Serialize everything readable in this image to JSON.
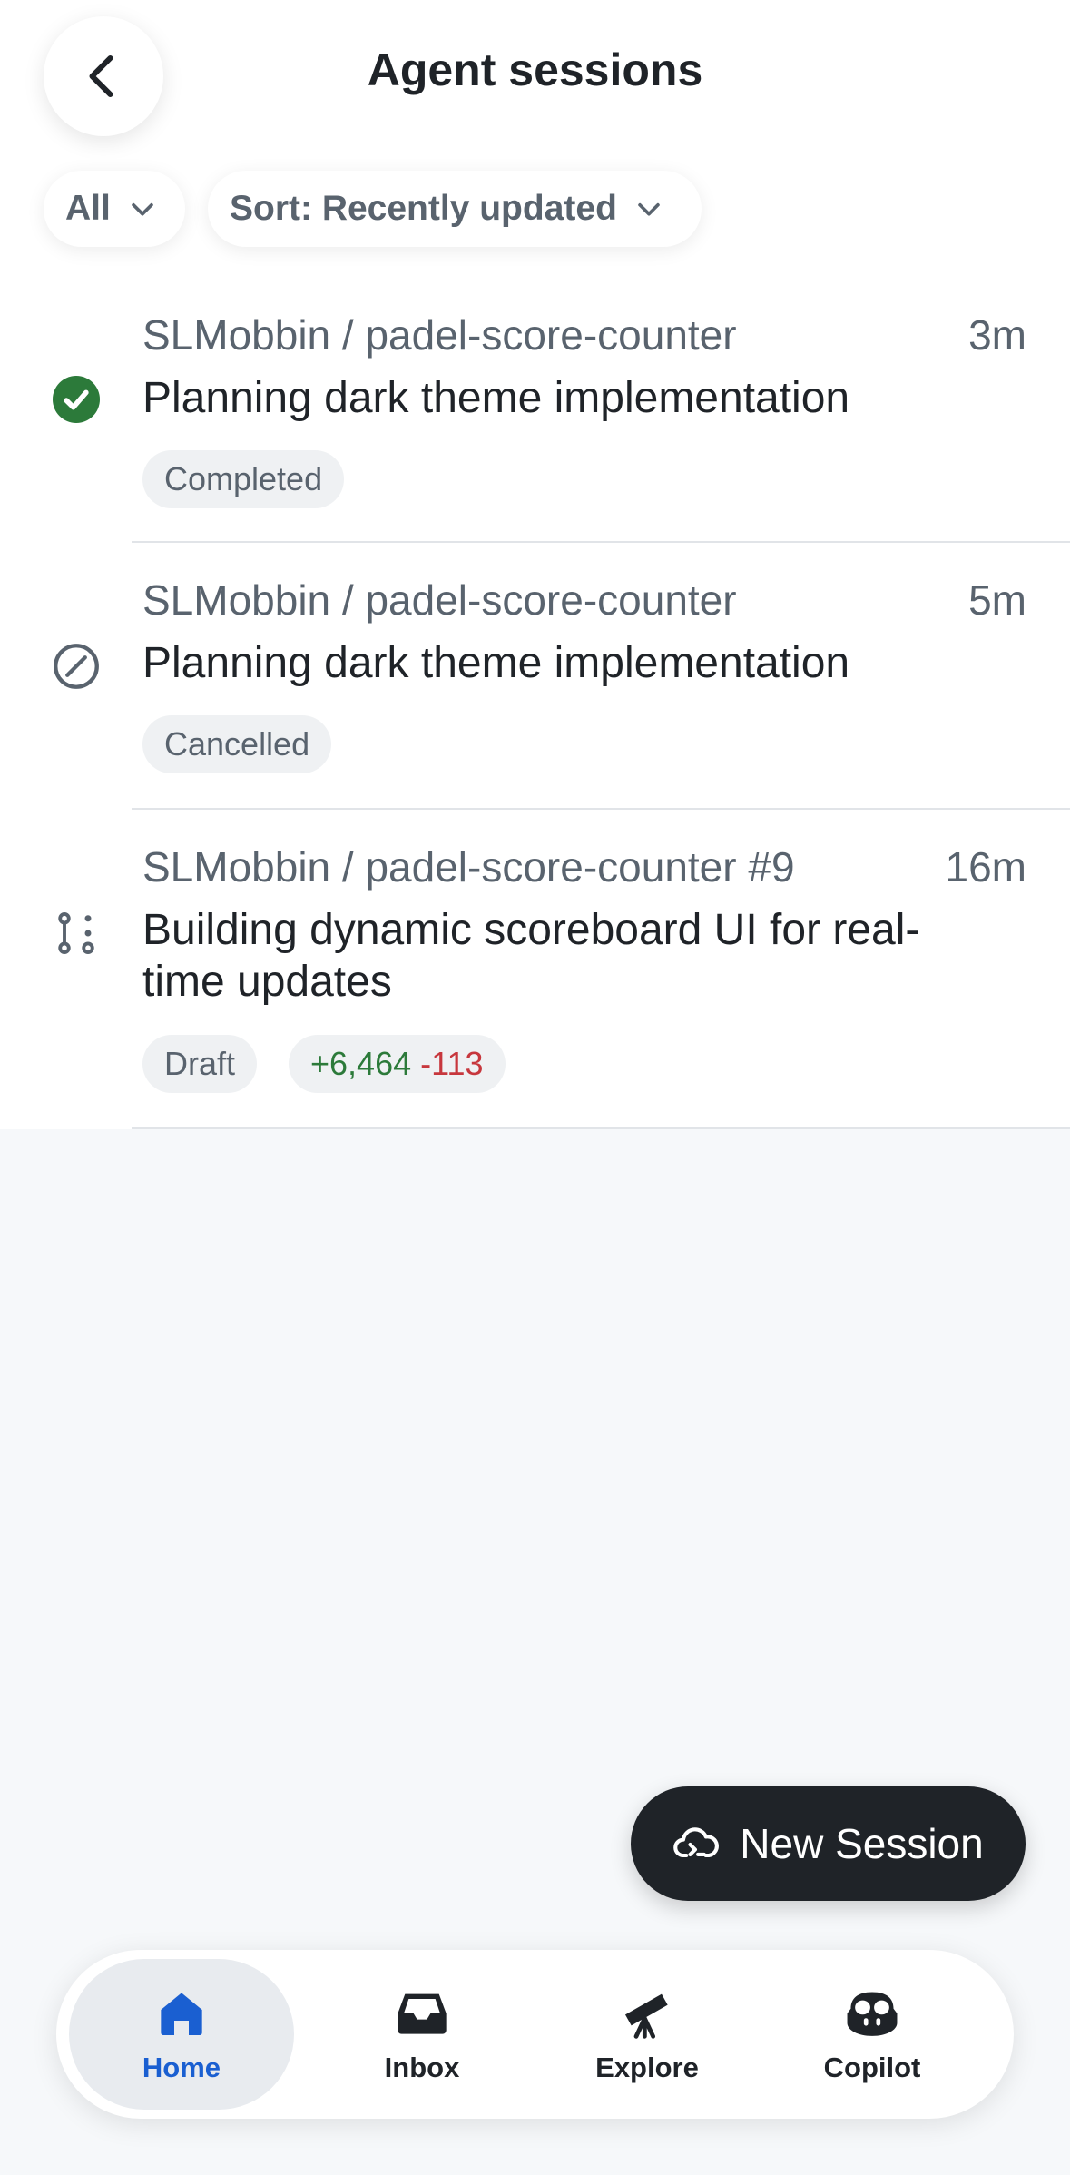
{
  "header": {
    "title": "Agent sessions",
    "back_icon": "chevron-left-icon",
    "filter_label": "All",
    "sort_label": "Sort: Recently updated"
  },
  "sessions": [
    {
      "repo": "SLMobbin / padel-score-counter",
      "time": "3m",
      "title": "Planning dark theme implementation",
      "status_icon": "check-circle-icon",
      "badge": "Completed"
    },
    {
      "repo": "SLMobbin / padel-score-counter",
      "time": "5m",
      "title": "Planning dark theme implementation",
      "status_icon": "cancelled-icon",
      "badge": "Cancelled"
    },
    {
      "repo": "SLMobbin / padel-score-counter #9",
      "time": "16m",
      "title": "Building dynamic scoreboard UI for real-time updates",
      "status_icon": "draft-pull-request-icon",
      "badge": "Draft",
      "additions": "+6,464",
      "deletions": "-113"
    }
  ],
  "fab": {
    "label": "New Session",
    "icon": "cloud-agent-icon"
  },
  "nav": {
    "items": [
      {
        "label": "Home",
        "icon": "home-icon"
      },
      {
        "label": "Inbox",
        "icon": "inbox-icon"
      },
      {
        "label": "Explore",
        "icon": "telescope-icon"
      },
      {
        "label": "Copilot",
        "icon": "copilot-icon"
      }
    ],
    "active": "Home"
  },
  "colors": {
    "success": "#2c7a3a",
    "danger": "#c7373d",
    "accent": "#1a5fd1",
    "fab_bg": "#1f2328"
  }
}
